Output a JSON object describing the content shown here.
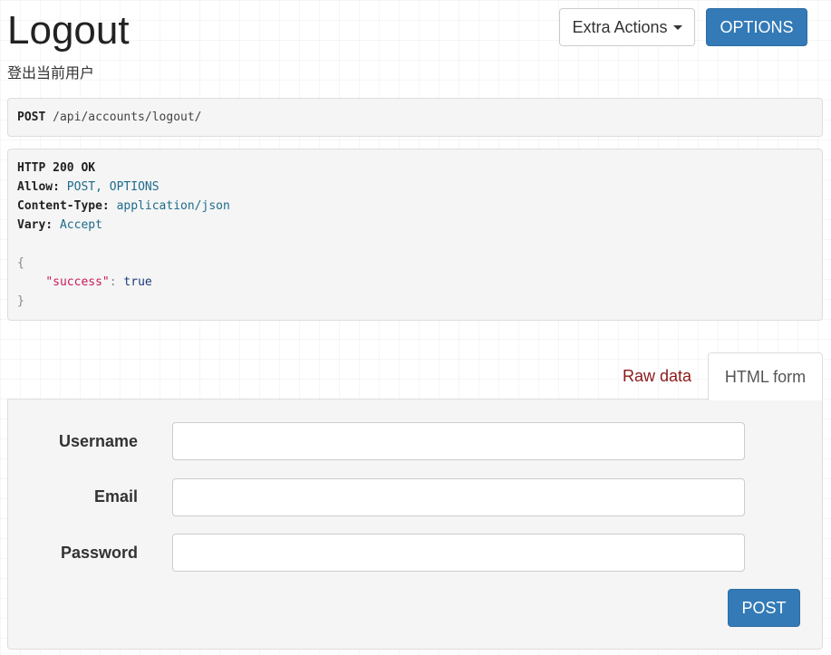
{
  "header": {
    "title": "Logout",
    "description": "登出当前用户",
    "extra_actions_label": "Extra Actions",
    "options_label": "OPTIONS"
  },
  "request": {
    "method": "POST",
    "path": "/api/accounts/logout/"
  },
  "response": {
    "status_line": "HTTP 200 OK",
    "headers": [
      {
        "key": "Allow:",
        "value": "POST, OPTIONS"
      },
      {
        "key": "Content-Type:",
        "value": "application/json"
      },
      {
        "key": "Vary:",
        "value": "Accept"
      }
    ],
    "body_open": "{",
    "body_key": "\"success\"",
    "body_colon": ": ",
    "body_value": "true",
    "body_close": "}"
  },
  "tabs": {
    "raw_data": "Raw data",
    "html_form": "HTML form"
  },
  "form": {
    "fields": [
      {
        "label": "Username",
        "value": ""
      },
      {
        "label": "Email",
        "value": ""
      },
      {
        "label": "Password",
        "value": ""
      }
    ],
    "submit_label": "POST"
  },
  "colors": {
    "primary": "#337ab7",
    "tab_link": "#8b1a1a",
    "json_key": "#c41a5a",
    "header_value": "#1d6b8a"
  }
}
